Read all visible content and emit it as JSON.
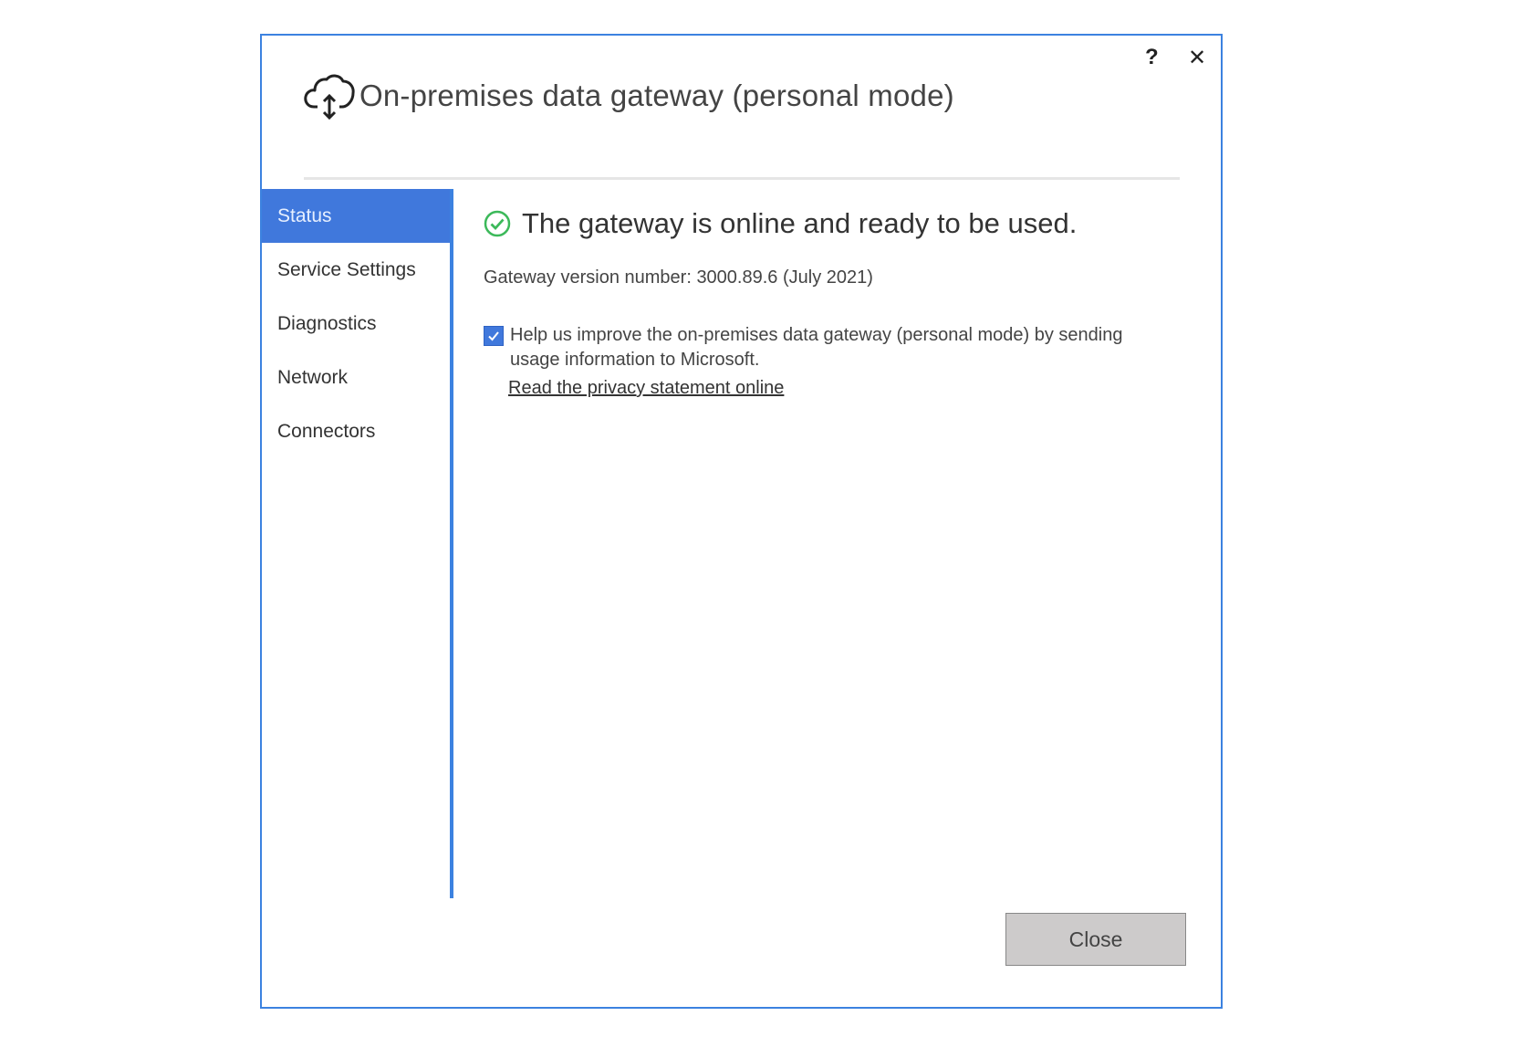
{
  "window": {
    "title": "On-premises data gateway (personal mode)",
    "help_label": "?",
    "close_label": "✕",
    "accent_color": "#4078dc"
  },
  "sidebar": {
    "items": [
      {
        "label": "Status",
        "active": true
      },
      {
        "label": "Service Settings",
        "active": false
      },
      {
        "label": "Diagnostics",
        "active": false
      },
      {
        "label": "Network",
        "active": false
      },
      {
        "label": "Connectors",
        "active": false
      }
    ]
  },
  "status": {
    "icon": "check-circle-icon",
    "icon_color": "#3cb95a",
    "message": "The gateway is online and ready to be used.",
    "version_text": "Gateway version number: 3000.89.6 (July 2021)"
  },
  "telemetry": {
    "checked": true,
    "label": "Help us improve the on-premises data gateway (personal mode) by sending usage information to Microsoft.",
    "privacy_link": "Read the privacy statement online"
  },
  "footer": {
    "close_button": "Close"
  }
}
